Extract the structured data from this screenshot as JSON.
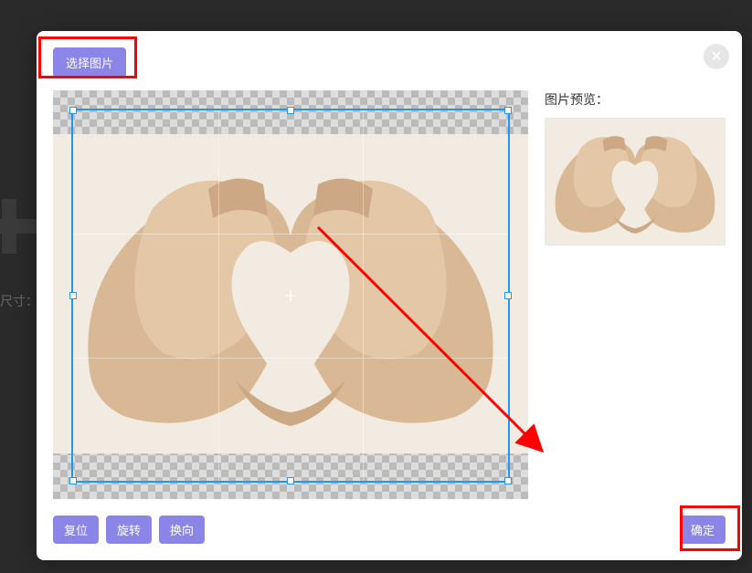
{
  "background": {
    "size_hint_prefix": "尺寸："
  },
  "modal": {
    "select_image_label": "选择图片",
    "close_symbol": "✕",
    "preview_label": "图片预览：",
    "footer": {
      "reset_label": "复位",
      "rotate_label": "旋转",
      "flip_label": "换向",
      "confirm_label": "确定"
    }
  },
  "annotations": {
    "highlight_color": "#ff0000",
    "arrow_color": "#ff0000"
  }
}
